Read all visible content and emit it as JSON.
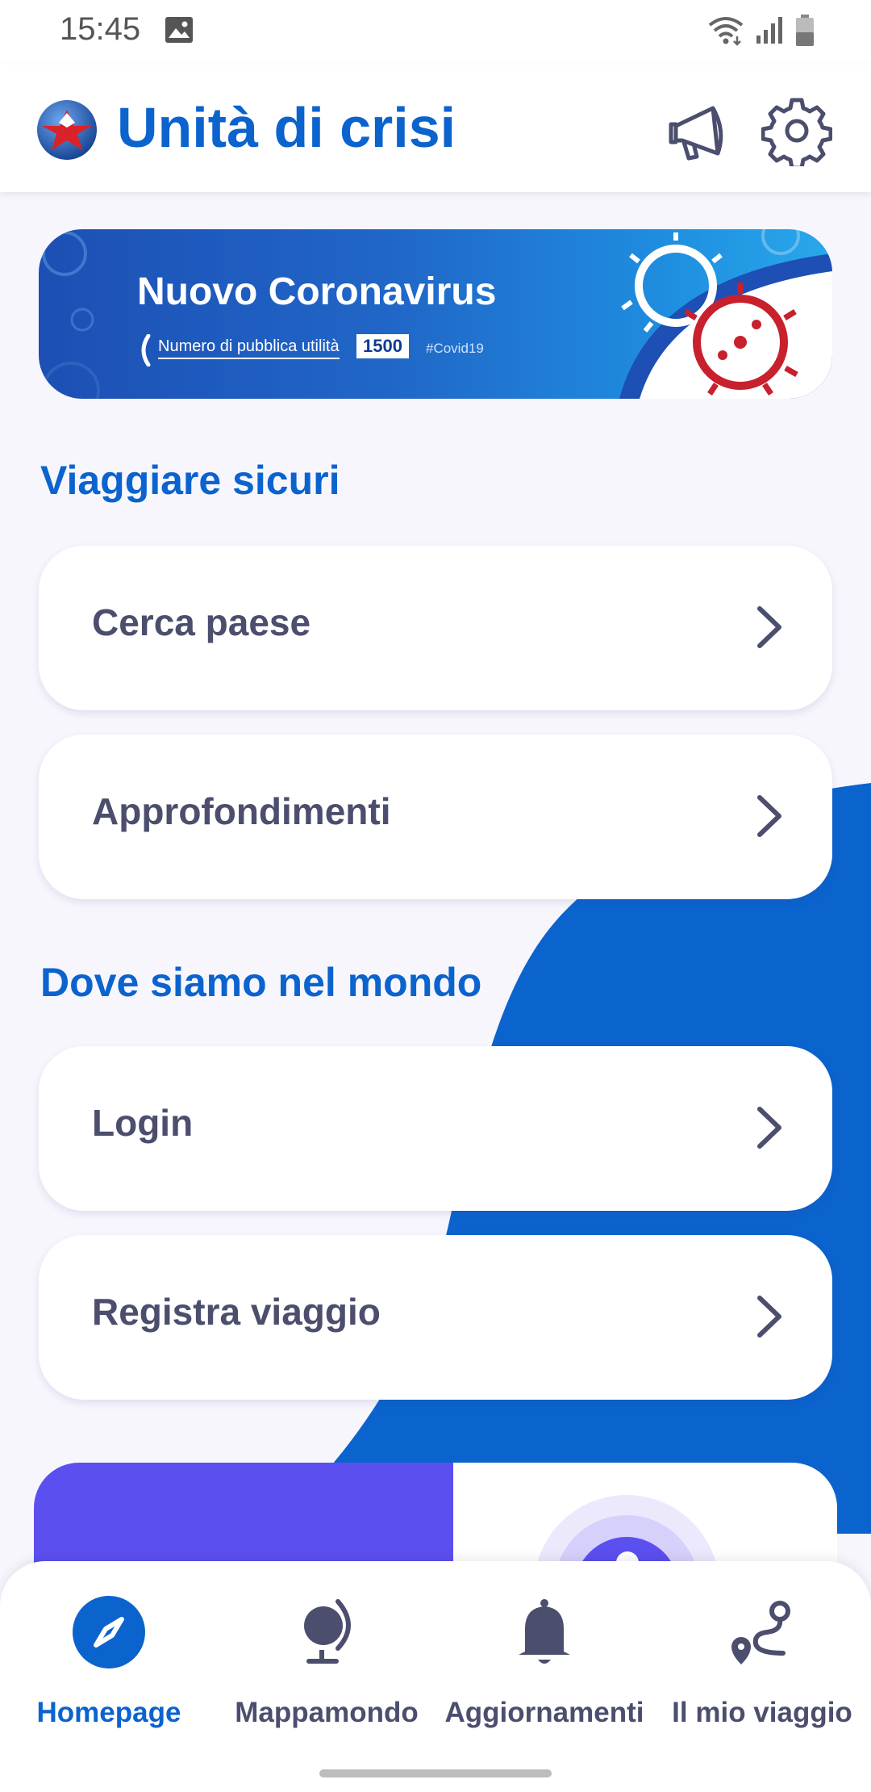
{
  "status_bar": {
    "time": "15:45"
  },
  "header": {
    "title": "Unità di crisi"
  },
  "banner": {
    "title": "Nuovo Coronavirus",
    "subtitle": "Numero di pubblica utilità",
    "number": "1500",
    "hashtag": "#Covid19"
  },
  "sections": [
    {
      "title": "Viaggiare sicuri",
      "items": [
        {
          "label": "Cerca paese"
        },
        {
          "label": "Approfondimenti"
        }
      ]
    },
    {
      "title": "Dove siamo nel mondo",
      "items": [
        {
          "label": "Login"
        },
        {
          "label": "Registra viaggio"
        }
      ]
    }
  ],
  "bottom_nav": [
    {
      "label": "Homepage",
      "icon": "compass-icon",
      "active": true
    },
    {
      "label": "Mappamondo",
      "icon": "globe-icon",
      "active": false
    },
    {
      "label": "Aggiornamenti",
      "icon": "bell-icon",
      "active": false
    },
    {
      "label": "Il mio viaggio",
      "icon": "route-icon",
      "active": false
    }
  ],
  "colors": {
    "accent": "#0b63ce",
    "text": "#4b4e6d",
    "promo": "#5b4ff0"
  }
}
